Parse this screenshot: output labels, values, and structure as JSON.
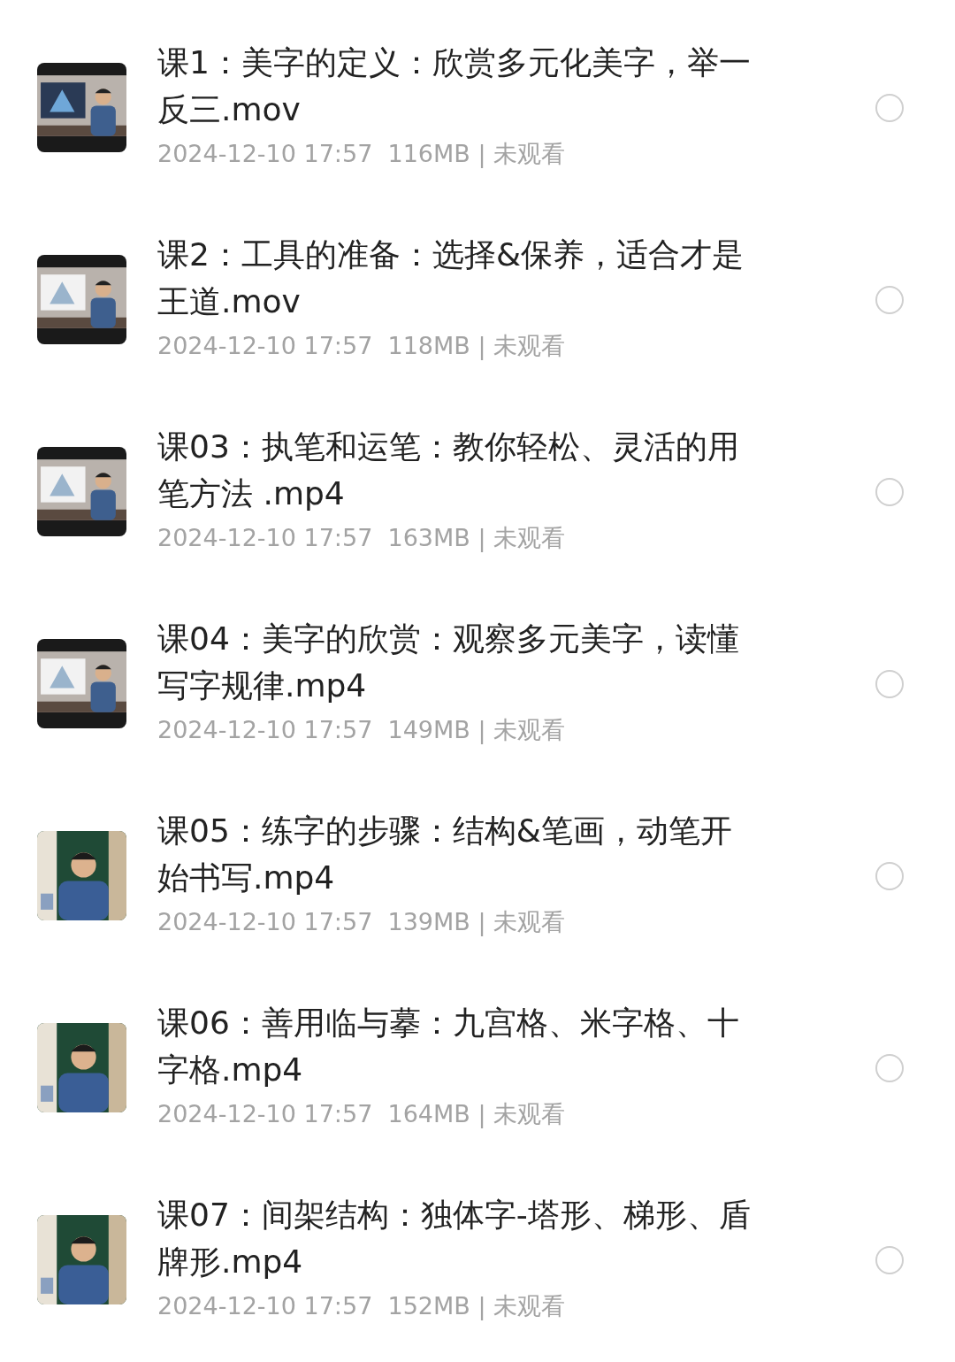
{
  "files": [
    {
      "title": "课1：美字的定义：欣赏多元化美字，举一反三.mov",
      "meta": "2024-12-10 17:57  116MB | 未观看",
      "selected": false
    },
    {
      "title": "课2：工具的准备：选择&保养，适合才是王道.mov",
      "meta": "2024-12-10 17:57  118MB | 未观看",
      "selected": false
    },
    {
      "title": "课03：执笔和运笔：教你轻松、灵活的用笔方法 .mp4",
      "meta": "2024-12-10 17:57  163MB | 未观看",
      "selected": false
    },
    {
      "title": "课04：美字的欣赏：观察多元美字，读懂写字规律.mp4",
      "meta": "2024-12-10 17:57  149MB | 未观看",
      "selected": false
    },
    {
      "title": "课05：练字的步骤：结构&笔画，动笔开始书写.mp4",
      "meta": "2024-12-10 17:57  139MB | 未观看",
      "selected": false
    },
    {
      "title": "课06：善用临与摹：九宫格、米字格、十字格.mp4",
      "meta": "2024-12-10 17:57  164MB | 未观看",
      "selected": false
    },
    {
      "title": "课07：间架结构：独体字-塔形、梯形、盾牌形.mp4",
      "meta": "2024-12-10 17:57  152MB | 未观看",
      "selected": false
    }
  ]
}
